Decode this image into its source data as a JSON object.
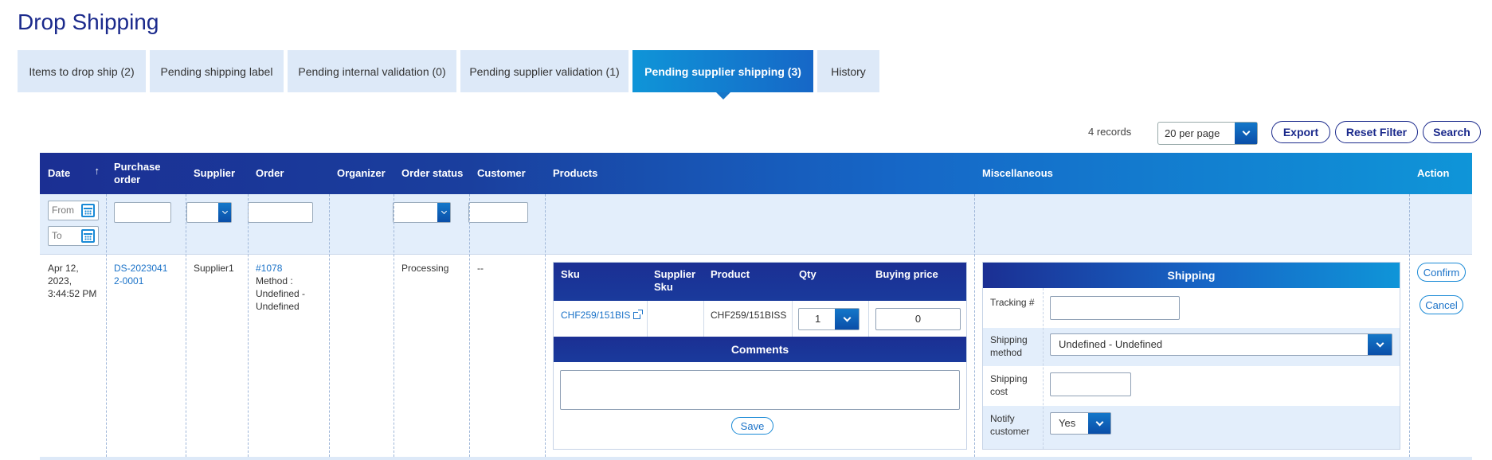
{
  "page": {
    "title": "Drop Shipping"
  },
  "tabs": [
    {
      "label": "Items to drop ship (2)",
      "active": false
    },
    {
      "label": "Pending shipping label",
      "active": false
    },
    {
      "label": "Pending internal validation (0)",
      "active": false
    },
    {
      "label": "Pending supplier validation (1)",
      "active": false
    },
    {
      "label": "Pending supplier shipping (3)",
      "active": true
    },
    {
      "label": "History",
      "active": false
    }
  ],
  "toolbar": {
    "records": "4 records",
    "per_page": "20 per page",
    "export": "Export",
    "reset_filter": "Reset Filter",
    "search": "Search"
  },
  "columns": {
    "date": "Date",
    "sort_indicator": "↑",
    "purchase_order": "Purchase order",
    "supplier": "Supplier",
    "order": "Order",
    "organizer": "Organizer",
    "order_status": "Order status",
    "customer": "Customer",
    "products": "Products",
    "miscellaneous": "Miscellaneous",
    "action": "Action"
  },
  "filters": {
    "date_from_placeholder": "From",
    "date_to_placeholder": "To"
  },
  "row": {
    "date": "Apr 12, 2023, 3:44:52 PM",
    "purchase_order": "DS-20230412-0001",
    "supplier": "Supplier1",
    "order_number": "#1078",
    "order_method": "Method : Undefined - Undefined",
    "organizer": "",
    "order_status": "Processing",
    "customer": "--",
    "products": {
      "headers": {
        "sku": "Sku",
        "supplier_sku": "Supplier Sku",
        "product": "Product",
        "qty": "Qty",
        "buying_price": "Buying price"
      },
      "items": [
        {
          "sku": "CHF259/151BIS",
          "supplier_sku": "",
          "product": "CHF259/151BISS",
          "qty": "1",
          "buying_price": "0"
        }
      ],
      "comments_title": "Comments",
      "comments_value": "",
      "save": "Save"
    },
    "misc": {
      "title": "Shipping",
      "tracking_label": "Tracking #",
      "tracking_value": "",
      "method_label": "Shipping method",
      "method_value": "Undefined - Undefined",
      "cost_label": "Shipping cost",
      "cost_value": "",
      "notify_label": "Notify customer",
      "notify_value": "Yes"
    },
    "actions": {
      "confirm": "Confirm",
      "cancel": "Cancel"
    }
  },
  "colors": {
    "title": "#1b2a8c",
    "tab_bg": "#dde9f8",
    "tab_active_start": "#0f95d8",
    "tab_active_end": "#1667c7",
    "header_dark": "#1b2f93",
    "link": "#1a72c8",
    "filter_bg": "#e3eefb"
  },
  "icons": [
    "calendar-icon",
    "chevron-down-icon",
    "external-link-icon",
    "sort-up-icon"
  ]
}
